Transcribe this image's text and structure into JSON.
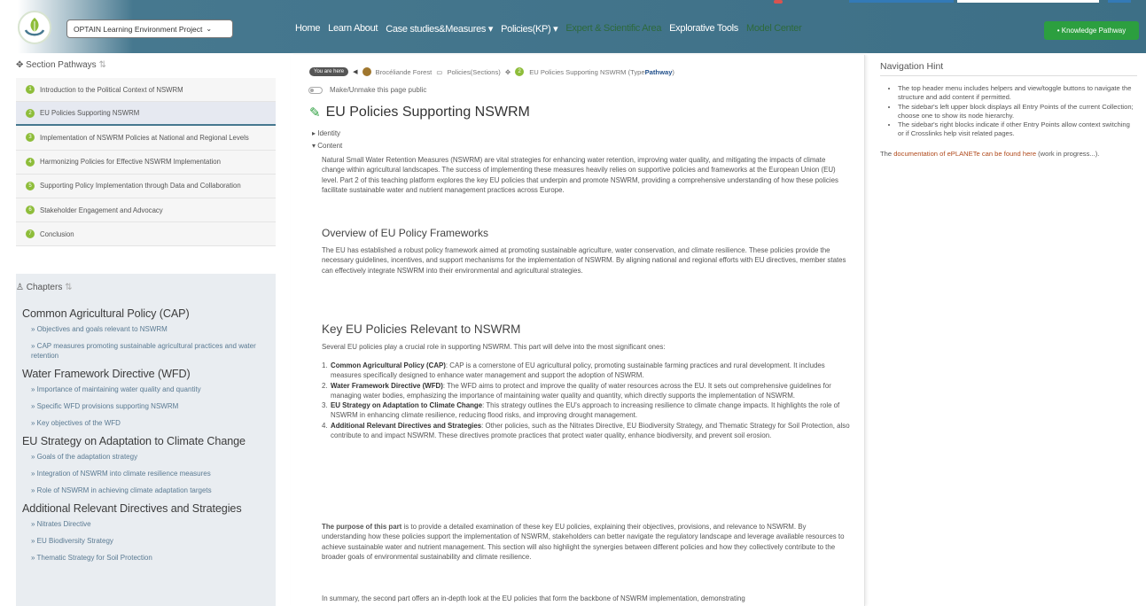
{
  "header": {
    "project_select": "OPTAIN Learning Environment Project",
    "nav": [
      {
        "label": "Home",
        "dim": false
      },
      {
        "label": "Learn About",
        "dim": false
      },
      {
        "label": "Case studies&Measures ▾",
        "dim": false
      },
      {
        "label": "Policies(KP) ▾",
        "dim": false
      },
      {
        "label": "Expert & Scientific Area",
        "dim": true
      },
      {
        "label": "Explorative Tools",
        "dim": false
      },
      {
        "label": "Model Center",
        "dim": true
      }
    ],
    "knowledge_button": "• Knowledge Pathway"
  },
  "sidebar": {
    "section_pathways_title": "Section Pathways",
    "pathways": [
      {
        "num": "1",
        "label": "Introduction to the Political Context of NSWRM"
      },
      {
        "num": "2",
        "label": "EU Policies Supporting NSWRM"
      },
      {
        "num": "3",
        "label": "Implementation of NSWRM Policies at National and Regional Levels"
      },
      {
        "num": "4",
        "label": "Harmonizing Policies for Effective NSWRM Implementation"
      },
      {
        "num": "5",
        "label": "Supporting Policy Implementation through Data and Collaboration"
      },
      {
        "num": "6",
        "label": "Stakeholder Engagement and Advocacy"
      },
      {
        "num": "7",
        "label": "Conclusion"
      }
    ],
    "chapters_title": "Chapters",
    "chapters": [
      {
        "title": "Common Agricultural Policy (CAP)",
        "links": [
          "Objectives and goals relevant to NSWRM",
          "CAP measures promoting sustainable agricultural practices and water retention"
        ]
      },
      {
        "title": "Water Framework Directive (WFD)",
        "links": [
          "Importance of maintaining water quality and quantity",
          "Specific WFD provisions supporting NSWRM",
          "Key objectives of the WFD"
        ]
      },
      {
        "title": "EU Strategy on Adaptation to Climate Change",
        "links": [
          "Goals of the adaptation strategy",
          "Integration of NSWRM into climate resilience measures",
          "Role of NSWRM in achieving climate adaptation targets"
        ]
      },
      {
        "title": "Additional Relevant Directives and Strategies",
        "links": [
          "Nitrates Directive",
          "EU Biodiversity Strategy",
          "Thematic Strategy for Soil Protection"
        ]
      }
    ]
  },
  "breadcrumb": {
    "badge": "You are here",
    "forest": "Brocéliande Forest",
    "policies": "Policies(Sections)",
    "current_prefix": "EU Policies Supporting NSWRM (Type ",
    "current_type": "Pathway",
    "current_suffix": ")"
  },
  "main": {
    "public_toggle": "Make/Unmake this page public",
    "title": "EU Policies Supporting NSWRM",
    "identity": "Identity",
    "content": "Content",
    "intro": "Natural Small Water Retention Measures (NSWRM) are vital strategies for enhancing water retention, improving water quality, and mitigating the impacts of climate change within agricultural landscapes. The success of implementing these measures heavily relies on supportive policies and frameworks at the European Union (EU) level. Part 2 of this teaching platform explores the key EU policies that underpin and promote NSWRM, providing a comprehensive understanding of how these policies facilitate sustainable water and nutrient management practices across Europe.",
    "overview_heading": "Overview of EU Policy Frameworks",
    "overview_text": "The EU has established a robust policy framework aimed at promoting sustainable agriculture, water conservation, and climate resilience. These policies provide the necessary guidelines, incentives, and support mechanisms for the implementation of NSWRM. By aligning national and regional efforts with EU directives, member states can effectively integrate NSWRM into their environmental and agricultural strategies.",
    "key_heading": "Key EU Policies Relevant to NSWRM",
    "key_intro": "Several EU policies play a crucial role in supporting NSWRM. This part will delve into the most significant ones:",
    "key_items": [
      {
        "num": "1.",
        "bold": "Common Agricultural Policy (CAP)",
        "text": ": CAP is a cornerstone of EU agricultural policy, promoting sustainable farming practices and rural development. It includes measures specifically designed to enhance water management and support the adoption of NSWRM."
      },
      {
        "num": "2.",
        "bold": "Water Framework Directive (WFD)",
        "text": ": The WFD aims to protect and improve the quality of water resources across the EU. It sets out comprehensive guidelines for managing water bodies, emphasizing the importance of maintaining water quality and quantity, which directly supports the implementation of NSWRM."
      },
      {
        "num": "3.",
        "bold": "EU Strategy on Adaptation to Climate Change",
        "text": ": This strategy outlines the EU's approach to increasing resilience to climate change impacts. It highlights the role of NSWRM in enhancing climate resilience, reducing flood risks, and improving drought management."
      },
      {
        "num": "4.",
        "bold": "Additional Relevant Directives and Strategies",
        "text": ": Other policies, such as the Nitrates Directive, EU Biodiversity Strategy, and Thematic Strategy for Soil Protection, also contribute to and impact NSWRM. These directives promote practices that protect water quality, enhance biodiversity, and prevent soil erosion."
      }
    ],
    "purpose_bold": "The purpose of this part",
    "purpose_text": " is to provide a detailed examination of these key EU policies, explaining their objectives, provisions, and relevance to NSWRM. By understanding how these policies support the implementation of NSWRM, stakeholders can better navigate the regulatory landscape and leverage available resources to achieve sustainable water and nutrient management. This section will also highlight the synergies between different policies and how they collectively contribute to the broader goals of environmental sustainability and climate resilience.",
    "summary_text": "In summary, the second part offers an in-depth look at the EU policies that form the backbone of NSWRM implementation, demonstrating"
  },
  "nav_hint": {
    "title": "Navigation Hint",
    "items": [
      "The top header menu includes helpers and view/toggle buttons to navigate the structure and add content if permitted.",
      "The sidebar's left upper block displays all Entry Points of the current Collection; choose one to show its node hierarchy.",
      "The sidebar's right blocks indicate if other Entry Points allow context switching or if Crosslinks help visit related pages."
    ],
    "doc_prefix": "The ",
    "doc_link": "documentation of ePLANETe can be found here",
    "doc_suffix": " (work in progress...)."
  },
  "colors": {
    "header_bg": "#3d6f86",
    "accent_green": "#2c9f3f",
    "pathway_dot": "#8ebd3a",
    "doc_link": "#b04a1c"
  }
}
